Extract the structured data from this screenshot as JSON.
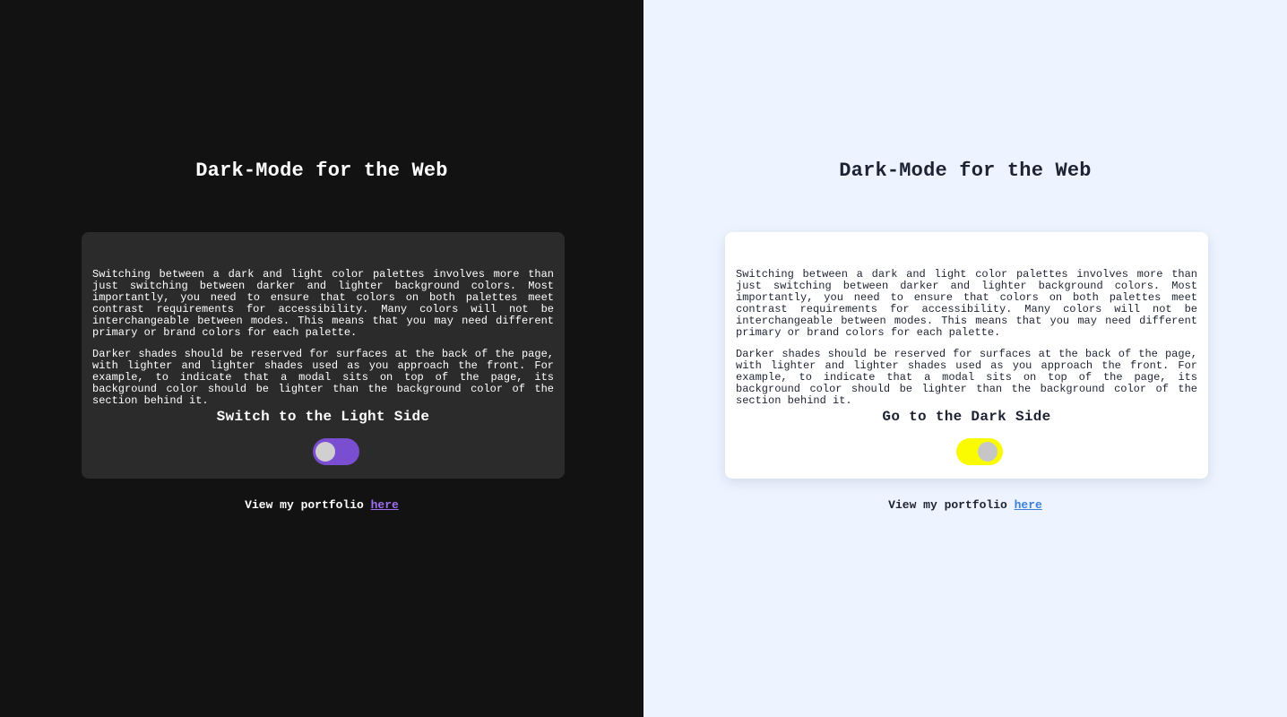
{
  "dark_panel": {
    "title": "Dark-Mode for the Web",
    "paragraphs": [
      "Switching between a dark and light color palettes involves more than just switching between darker and lighter background colors. Most importantly, you need to ensure that colors on both palettes meet contrast requirements for accessibility. Many colors will not be interchangeable between modes. This means that you may need different primary or brand colors for each palette.",
      "Darker shades should be reserved for surfaces at the back of the page, with lighter and lighter shades used as you approach the front. For example, to indicate that a modal sits on top of the page, its background color should be lighter than the background color of the section behind it."
    ],
    "toggle_heading": "Switch to the Light Side",
    "footer_text": "View my portfolio ",
    "footer_link": "here",
    "colors": {
      "background": "#121212",
      "card": "#2b2b2b",
      "toggle": "#7a4ed0",
      "link": "#9f6ff2"
    }
  },
  "light_panel": {
    "title": "Dark-Mode for the Web",
    "paragraphs": [
      "Switching between a dark and light color palettes involves more than just switching between darker and lighter background colors. Most importantly, you need to ensure that colors on both palettes meet contrast requirements for accessibility. Many colors will not be interchangeable between modes. This means that you may need different primary or brand colors for each palette.",
      "Darker shades should be reserved for surfaces at the back of the page, with lighter and lighter shades used as you approach the front. For example, to indicate that a modal sits on top of the page, its background color should be lighter than the background color of the section behind it."
    ],
    "toggle_heading": "Go to the Dark Side",
    "footer_text": "View my portfolio ",
    "footer_link": "here",
    "colors": {
      "background": "#eef4ff",
      "card": "#ffffff",
      "toggle": "#fbfb00",
      "link": "#3c7fd9"
    }
  }
}
